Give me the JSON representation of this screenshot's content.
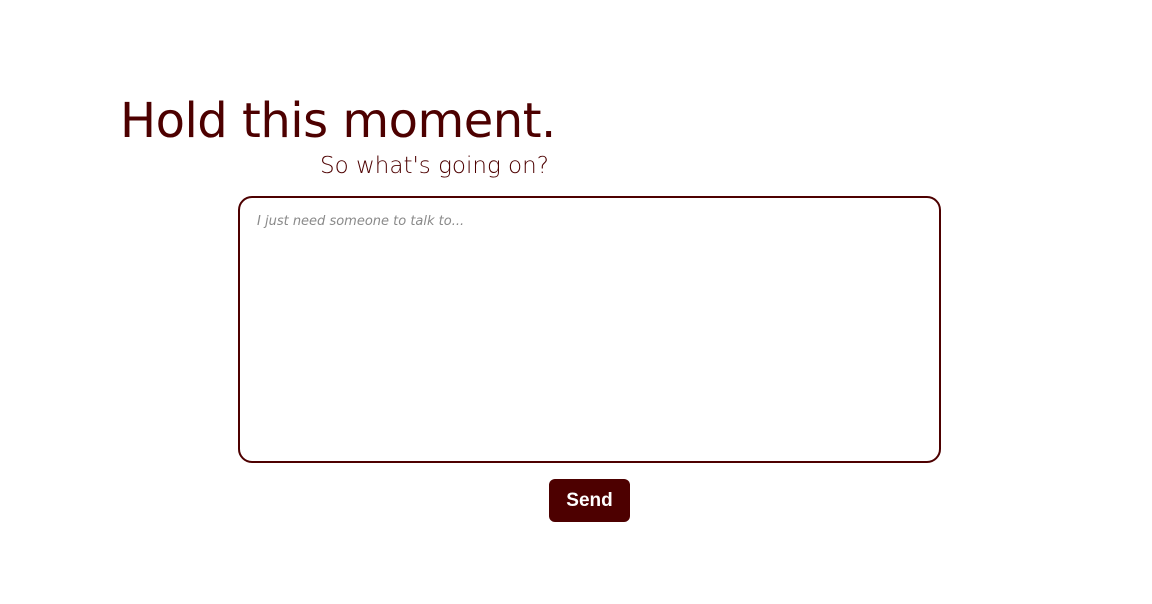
{
  "header": {
    "title": "Hold this moment.",
    "subtitle": "So what's going on?"
  },
  "form": {
    "message": {
      "value": "",
      "placeholder": "I just need someone to talk to..."
    },
    "send_label": "Send"
  },
  "colors": {
    "accent": "#4d0000",
    "background": "#ffffff",
    "placeholder": "#8a8a8a"
  }
}
